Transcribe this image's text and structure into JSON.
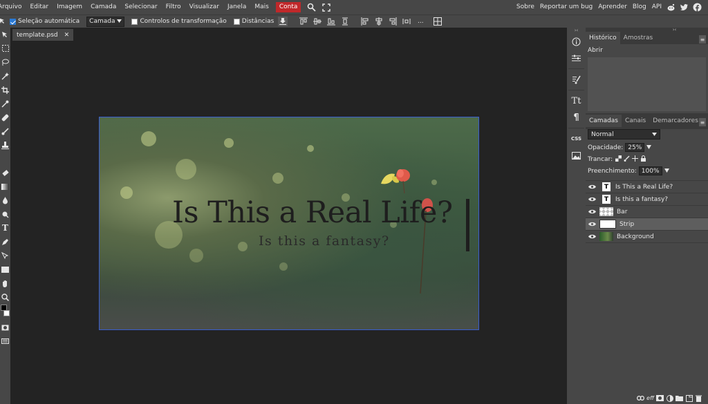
{
  "menu": {
    "items": [
      "Arquivo",
      "Editar",
      "Imagem",
      "Camada",
      "Selecionar",
      "Filtro",
      "Visualizar",
      "Janela",
      "Mais"
    ],
    "account": "Conta",
    "right_links": [
      "Sobre",
      "Reportar um bug",
      "Aprender",
      "Blog",
      "API"
    ],
    "social_icons": [
      "reddit-icon",
      "twitter-icon",
      "facebook-icon"
    ]
  },
  "options": {
    "auto_select_label": "Seleção automática",
    "auto_select_checked": true,
    "target_value": "Camada",
    "transform_label": "Controlos de transformação",
    "distances_label": "Distâncias",
    "more": "..."
  },
  "document": {
    "tab_name": "template.psd",
    "close": "✕"
  },
  "canvas": {
    "headline": "Is This a Real Life?",
    "subline": "Is this a fantasy?"
  },
  "history_panel": {
    "tabs": [
      "Histórico",
      "Amostras"
    ],
    "entries": [
      "Abrir"
    ]
  },
  "layers_panel": {
    "tabs": [
      "Camadas",
      "Canais",
      "Demarcadores"
    ],
    "blend_mode": "Normal",
    "opacity_label": "Opacidade:",
    "opacity_value": "25%",
    "lock_label": "Trancar:",
    "fill_label": "Preenchimento:",
    "fill_value": "100%",
    "layers": [
      {
        "name": "Is This a Real Life?",
        "kind": "text",
        "selected": false
      },
      {
        "name": "Is this a fantasy?",
        "kind": "text",
        "selected": false
      },
      {
        "name": "Bar",
        "kind": "raster-transparent",
        "selected": false
      },
      {
        "name": "Strip",
        "kind": "raster-white",
        "selected": true
      },
      {
        "name": "Background",
        "kind": "image",
        "selected": false
      }
    ]
  },
  "colors": {
    "accent": "#c0282a",
    "selection": "#3a5fd0",
    "panel": "#474747",
    "background": "#232323"
  }
}
